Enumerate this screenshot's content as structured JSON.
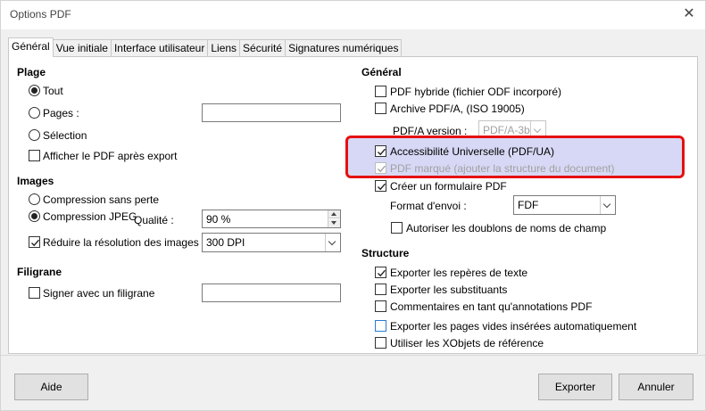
{
  "window": {
    "title": "Options PDF",
    "close_glyph": "✕"
  },
  "tabs": [
    {
      "label": "Général",
      "active": true
    },
    {
      "label": "Vue initiale"
    },
    {
      "label": "Interface utilisateur"
    },
    {
      "label": "Liens"
    },
    {
      "label": "Sécurité"
    },
    {
      "label": "Signatures numériques"
    }
  ],
  "plage": {
    "header": "Plage",
    "tout": "Tout",
    "pages": "Pages :",
    "pages_value": "",
    "selection": "Sélection",
    "afficher": "Afficher le PDF après export"
  },
  "images": {
    "header": "Images",
    "sans_perte": "Compression sans perte",
    "jpeg": "Compression JPEG",
    "qualite_label": "Qualité :",
    "qualite_value": "90 %",
    "reduire": "Réduire la résolution des images",
    "dpi_value": "300 DPI"
  },
  "filigrane": {
    "header": "Filigrane",
    "signer": "Signer avec un filigrane",
    "value": ""
  },
  "general": {
    "header": "Général",
    "hybride": "PDF hybride (fichier ODF incorporé)",
    "archive": "Archive PDF/A, (ISO 19005)",
    "pdfa_version_label": "PDF/A version :",
    "pdfa_version_value": "PDF/A-3b",
    "accessibilite": "Accessibilité Universelle (PDF/UA)",
    "marque": "PDF marqué (ajouter la structure du document)",
    "formulaire": "Créer un formulaire PDF",
    "format_label": "Format d'envoi :",
    "format_value": "FDF",
    "doublons": "Autoriser les doublons de noms de champ"
  },
  "structure": {
    "header": "Structure",
    "reperes": "Exporter les repères de texte",
    "substituants": "Exporter les substituants",
    "commentaires": "Commentaires en tant qu'annotations PDF",
    "pages_vides": "Exporter les pages vides insérées automatiquement",
    "xobjets": "Utiliser les XObjets de référence"
  },
  "buttons": {
    "aide": "Aide",
    "exporter": "Exporter",
    "annuler": "Annuler"
  },
  "colors": {
    "highlight_fill": "#d7d8f5",
    "highlight_border": "#e51010"
  }
}
